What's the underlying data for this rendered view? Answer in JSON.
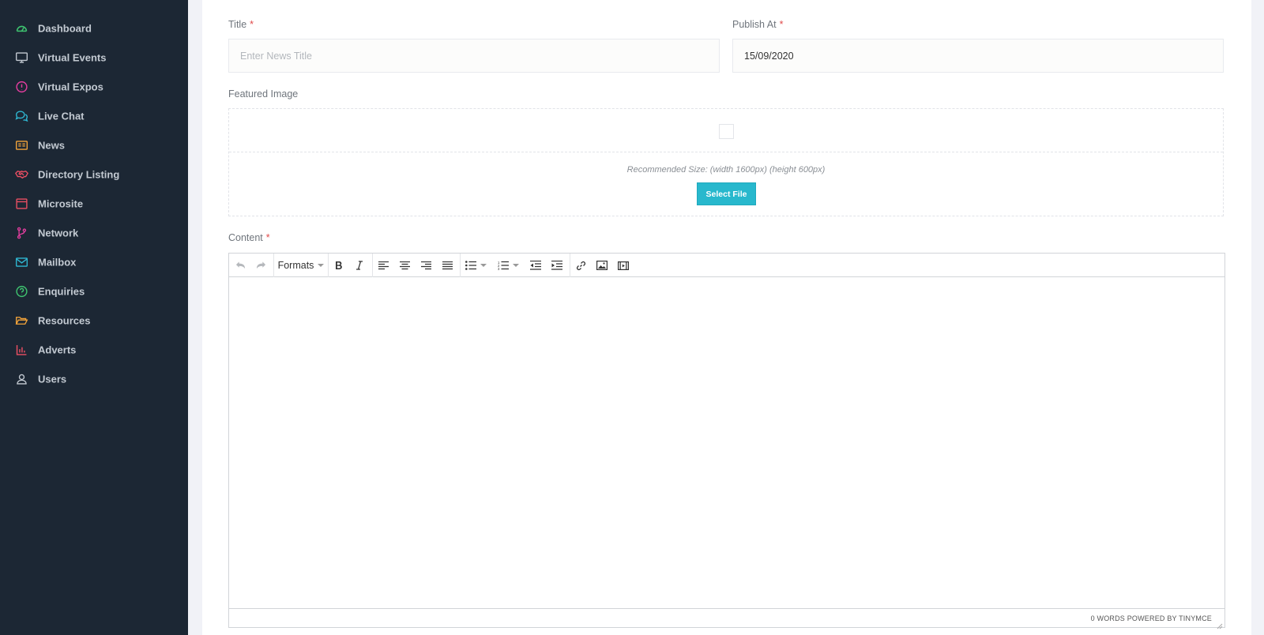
{
  "sidebar": {
    "items": [
      {
        "label": "Dashboard",
        "icon": "dashboard-icon",
        "color": "#3ec26f"
      },
      {
        "label": "Virtual Events",
        "icon": "monitor-icon",
        "color": "#c3cad2"
      },
      {
        "label": "Virtual Expos",
        "icon": "info-circle-icon",
        "color": "#e23d9e"
      },
      {
        "label": "Live Chat",
        "icon": "chat-icon",
        "color": "#2fb8d3"
      },
      {
        "label": "News",
        "icon": "newspaper-icon",
        "color": "#f3a43a"
      },
      {
        "label": "Directory Listing",
        "icon": "handshake-icon",
        "color": "#ec4f63"
      },
      {
        "label": "Microsite",
        "icon": "browser-window-icon",
        "color": "#ec4f63"
      },
      {
        "label": "Network",
        "icon": "branch-icon",
        "color": "#e23d9e"
      },
      {
        "label": "Mailbox",
        "icon": "mail-icon",
        "color": "#2fb8d3"
      },
      {
        "label": "Enquiries",
        "icon": "question-circle-icon",
        "color": "#3ec26f"
      },
      {
        "label": "Resources",
        "icon": "folder-open-icon",
        "color": "#f3a43a"
      },
      {
        "label": "Adverts",
        "icon": "bar-chart-icon",
        "color": "#ec4f63"
      },
      {
        "label": "Users",
        "icon": "user-icon",
        "color": "#c3cad2"
      }
    ]
  },
  "form": {
    "title_label": "Title",
    "title_placeholder": "Enter News Title",
    "title_value": "",
    "publish_label": "Publish At",
    "publish_value": "15/09/2020",
    "required_mark": "*",
    "featured_label": "Featured Image",
    "featured_hint": "Recommended Size: (width 1600px) (height 600px)",
    "select_file": "Select File",
    "content_label": "Content"
  },
  "editor": {
    "formats_label": "Formats",
    "status_text": "0 WORDS POWERED BY TINYMCE",
    "toolbar_icons": [
      "undo-icon",
      "redo-icon",
      "bold-icon",
      "italic-icon",
      "align-left-icon",
      "align-center-icon",
      "align-right-icon",
      "align-justify-icon",
      "bullet-list-icon",
      "numbered-list-icon",
      "outdent-icon",
      "indent-icon",
      "link-icon",
      "image-icon",
      "media-icon"
    ]
  },
  "colors": {
    "sidebar_bg": "#1c2734",
    "accent": "#28b8cd",
    "required": "#e04a4a"
  }
}
